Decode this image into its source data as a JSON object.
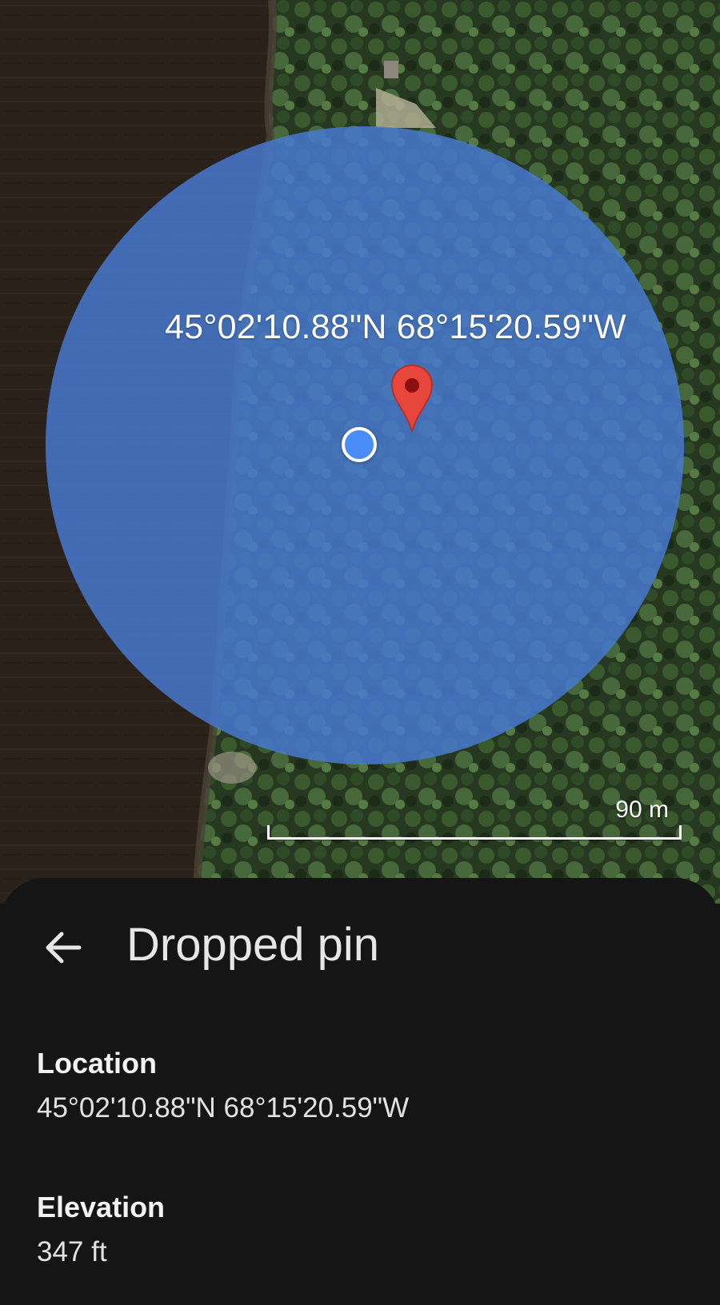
{
  "map": {
    "coordinate_label": "45°02'10.88\"N 68°15'20.59\"W",
    "scale_label": "90 m",
    "icons": {
      "pin": "red-map-pin-icon",
      "current_location": "blue-location-dot-icon"
    },
    "colors": {
      "accuracy_circle": "#487ad2",
      "pin": "#e8453c",
      "location_dot": "#4a8df8"
    }
  },
  "sheet": {
    "back_icon": "arrow-back-icon",
    "title": "Dropped pin",
    "location": {
      "label": "Location",
      "value": "45°02'10.88\"N 68°15'20.59\"W"
    },
    "elevation": {
      "label": "Elevation",
      "value": "347 ft"
    }
  }
}
